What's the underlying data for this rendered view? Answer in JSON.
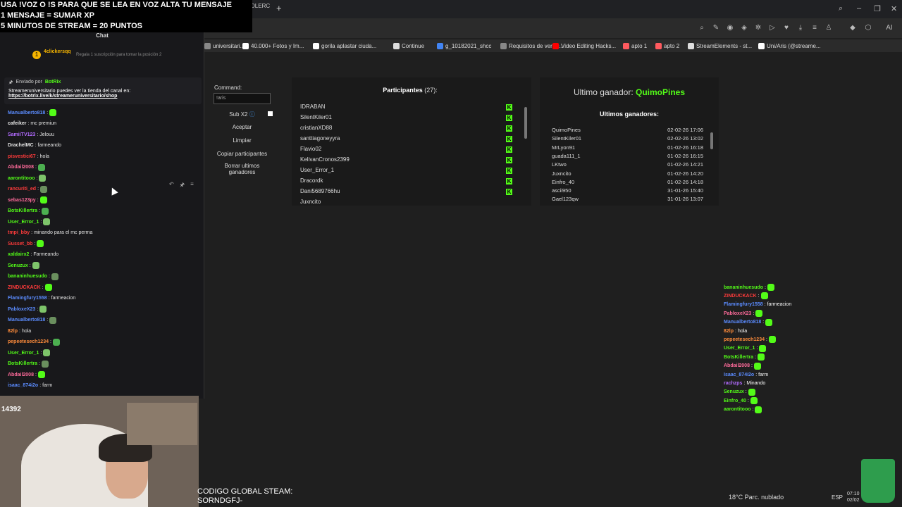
{
  "overlay": {
    "line1": "USA !VOZ O !S PARA QUE SE LEA EN VOZ ALTA TU MENSAJE",
    "line2": "1 MENSAJE = SUMAR XP",
    "line3": "5 MINUTOS DE STREAM = 20 PUNTOS"
  },
  "browser": {
    "tab_fragment": "DLERC",
    "bookmarks": [
      {
        "label": "universitari...",
        "color": "#888"
      },
      {
        "label": "40.000+ Fotos y Im...",
        "color": "#fff"
      },
      {
        "label": "gorila aplastar ciuda...",
        "color": "#fff"
      },
      {
        "label": "Continue",
        "color": "#ddd"
      },
      {
        "label": "g_10182021_shcc",
        "color": "#4285f4"
      },
      {
        "label": "Requisitos de verific...",
        "color": "#888"
      },
      {
        "label": "Video Editing Hacks...",
        "color": "#ff0000"
      },
      {
        "label": "apto 1",
        "color": "#ff5a5f"
      },
      {
        "label": "apto 2",
        "color": "#ff5a5f"
      },
      {
        "label": "StreamElements - st...",
        "color": "#ddd"
      },
      {
        "label": "Uni/Aris (@streame...",
        "color": "#fff"
      }
    ]
  },
  "chat": {
    "title": "Chat",
    "sub_user": "4clickersqq",
    "sub_text": "Regala 1 suscripción para tomar la posición 2",
    "pinned_by": "Enviado por",
    "pinned_bot": "BotRix",
    "pinned_msg": "Streameruniversitario puedes ver la tienda del canal en:",
    "pinned_link": "https://botrix.live/k/streameruniversitario/shop",
    "messages": [
      {
        "user": "Manualberto818",
        "color": "#5b8cff",
        "text": ""
      },
      {
        "user": "cafeiker",
        "color": "#e4e4e4",
        "text": "mc premiun"
      },
      {
        "user": "SamiiTV123",
        "color": "#b26bff",
        "text": "Jelouu"
      },
      {
        "user": "DrachelMC",
        "color": "#e4e4e4",
        "text": "farmeando"
      },
      {
        "user": "pisvestici67",
        "color": "#ff3b3b",
        "text": "hola"
      },
      {
        "user": "Abdail2008",
        "color": "#ff6b9b",
        "text": ""
      },
      {
        "user": "aarontitooo",
        "color": "#53fc18",
        "text": ""
      },
      {
        "user": "rancuriti_ed",
        "color": "#ff3b3b",
        "text": ""
      },
      {
        "user": "sebas123py",
        "color": "#ff6b9b",
        "text": ""
      },
      {
        "user": "BotsKillertra",
        "color": "#53fc18",
        "text": ""
      },
      {
        "user": "User_Error_1",
        "color": "#53fc18",
        "text": ""
      },
      {
        "user": "tmpi_bby",
        "color": "#ff3b3b",
        "text": "minando para el mc perma"
      },
      {
        "user": "Susset_bb",
        "color": "#ff3b3b",
        "text": ""
      },
      {
        "user": "xaldairx2",
        "color": "#53fc18",
        "text": "Farmeando"
      },
      {
        "user": "Senuzux",
        "color": "#53fc18",
        "text": ""
      },
      {
        "user": "bananinhuesudo",
        "color": "#53fc18",
        "text": ""
      },
      {
        "user": "ZINDUCKACK",
        "color": "#ff3b3b",
        "text": ""
      },
      {
        "user": "Flamingfury1558",
        "color": "#5b8cff",
        "text": "farmeacion"
      },
      {
        "user": "PabloxeX23",
        "color": "#5b8cff",
        "text": ""
      },
      {
        "user": "Manualberto818",
        "color": "#5b8cff",
        "text": ""
      },
      {
        "user": "82lp",
        "color": "#ff8c3b",
        "text": "hola"
      },
      {
        "user": "pepeetesech1234",
        "color": "#ff8c3b",
        "text": ""
      },
      {
        "user": "User_Error_1",
        "color": "#53fc18",
        "text": ""
      },
      {
        "user": "BotsKillertra",
        "color": "#53fc18",
        "text": ""
      },
      {
        "user": "Abdail2008",
        "color": "#ff6b9b",
        "text": ""
      },
      {
        "user": "isaac_874i2o",
        "color": "#5b8cff",
        "text": "farm"
      }
    ]
  },
  "cam": {
    "count": "14392"
  },
  "codigo": {
    "line1": "CODIGO GLOBAL STEAM:",
    "line2": "SORNDGFJ-"
  },
  "command": {
    "label": "Command:",
    "value": "!aris",
    "sub_label": "Sub X2",
    "buttons": [
      "Aceptar",
      "Limpiar",
      "Copiar participantes",
      "Borrar ultimos ganadores"
    ]
  },
  "participants": {
    "title": "Participantes",
    "count": "(27):",
    "list": [
      "IDRABAN",
      "SilentKiler01",
      "cristianXD88",
      "santtiagoneyyra",
      "Flavio02",
      "KelivanCronos2399",
      "User_Error_1",
      "Dracordk",
      "Dani5689766hu",
      "Juxncito"
    ]
  },
  "winners": {
    "last_label": "Ultimo ganador:",
    "last_name": "QuimoPines",
    "subtitle": "Ultimos ganadores:",
    "list": [
      {
        "name": "QuimoPines",
        "date": "02-02-26 17:06"
      },
      {
        "name": "SilentKiler01",
        "date": "02-02-26 13:02"
      },
      {
        "name": "MrLyon91",
        "date": "01-02-26 16:18"
      },
      {
        "name": "guada111_1",
        "date": "01-02-26 16:15"
      },
      {
        "name": "LKtwo",
        "date": "01-02-26 14:21"
      },
      {
        "name": "Juxncito",
        "date": "01-02-26 14:20"
      },
      {
        "name": "Einfro_40",
        "date": "01-02-26 14:18"
      },
      {
        "name": "ascii950",
        "date": "31-01-26 15:40"
      },
      {
        "name": "Gael123qw",
        "date": "31-01-26 13:07"
      }
    ]
  },
  "right_chat": [
    {
      "user": "bananinhuesudo",
      "color": "#53fc18",
      "text": ""
    },
    {
      "user": "ZINDUCKACK",
      "color": "#ff3b3b",
      "text": ""
    },
    {
      "user": "Flamingfury1558",
      "color": "#5b8cff",
      "text": "farmeacion"
    },
    {
      "user": "PabloxeX23",
      "color": "#ff6b9b",
      "text": ""
    },
    {
      "user": "Manualberto818",
      "color": "#5b8cff",
      "text": ""
    },
    {
      "user": "82lp",
      "color": "#ff8c3b",
      "text": "hola"
    },
    {
      "user": "pepeetesech1234",
      "color": "#ff8c3b",
      "text": ""
    },
    {
      "user": "User_Error_1",
      "color": "#53fc18",
      "text": ""
    },
    {
      "user": "BotsKillertra",
      "color": "#53fc18",
      "text": ""
    },
    {
      "user": "Abdail2008",
      "color": "#ff6b9b",
      "text": ""
    },
    {
      "user": "Isaac_874i2o",
      "color": "#5b8cff",
      "text": "farm"
    },
    {
      "user": "rachzps",
      "color": "#b26bff",
      "text": "Minando"
    },
    {
      "user": "Senuzux",
      "color": "#53fc18",
      "text": ""
    },
    {
      "user": "Einfro_40",
      "color": "#53fc18",
      "text": ""
    },
    {
      "user": "aarontitooo",
      "color": "#53fc18",
      "text": ""
    }
  ],
  "taskbar": {
    "weather": "18°C  Parc. nublado",
    "lang": "ESP",
    "time": "07:10",
    "date": "02/02"
  }
}
